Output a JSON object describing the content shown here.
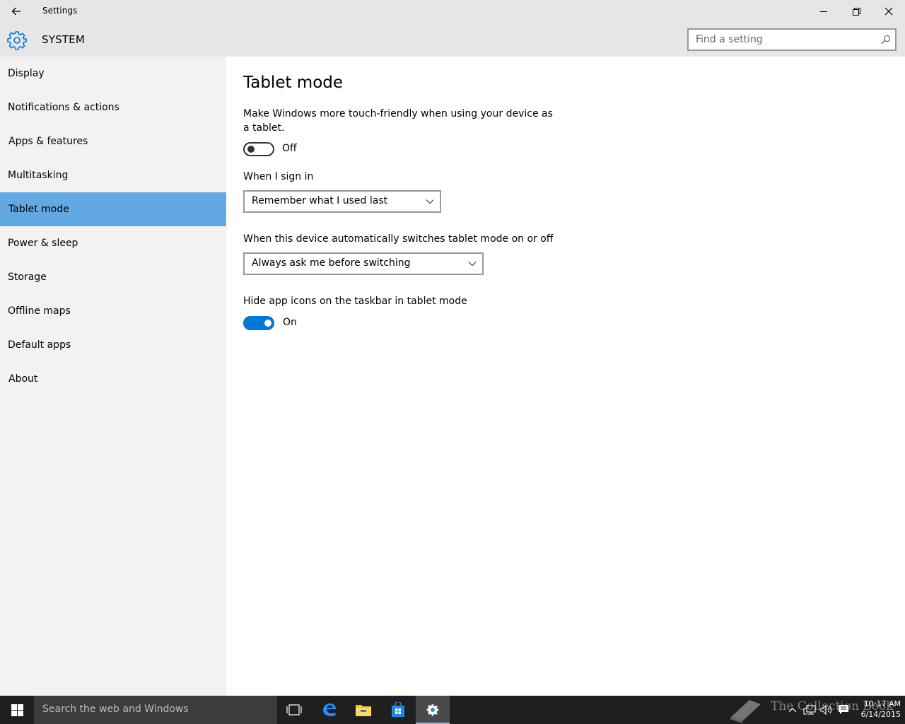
{
  "window": {
    "title": "Settings",
    "controls": [
      "minimize",
      "restore",
      "close"
    ]
  },
  "header": {
    "section_title": "SYSTEM",
    "search_placeholder": "Find a setting"
  },
  "sidebar": {
    "items": [
      {
        "label": "Display"
      },
      {
        "label": "Notifications & actions"
      },
      {
        "label": "Apps & features"
      },
      {
        "label": "Multitasking"
      },
      {
        "label": "Tablet mode",
        "selected": true
      },
      {
        "label": "Power & sleep"
      },
      {
        "label": "Storage"
      },
      {
        "label": "Offline maps"
      },
      {
        "label": "Default apps"
      },
      {
        "label": "About"
      }
    ]
  },
  "main": {
    "title": "Tablet mode",
    "tablet_description": "Make Windows more touch-friendly when using your device as a tablet.",
    "tablet_toggle": {
      "state": "Off",
      "on": false
    },
    "sign_in": {
      "label": "When I sign in",
      "selected": "Remember what I used last"
    },
    "auto_switch": {
      "label": "When this device automatically switches tablet mode on or off",
      "selected": "Always ask me before switching"
    },
    "hide_icons": {
      "label": "Hide app icons on the taskbar in tablet mode",
      "state": "On",
      "on": true
    }
  },
  "taskbar": {
    "search_placeholder": "Search the web and Windows",
    "pinned_icons": [
      "task-view-icon",
      "edge-icon",
      "file-explorer-icon",
      "store-icon",
      "settings-icon"
    ],
    "active_icon": "settings-icon",
    "time": "10:17 AM",
    "date": "6/14/2015",
    "watermark": "The Collection Book"
  },
  "colors": {
    "accent": "#0078d7",
    "selected_nav": "#62a8e3",
    "sidebar_bg": "#f2f2f2",
    "header_bg": "#e6e6e6",
    "taskbar_bg": "#1f1f1f"
  }
}
